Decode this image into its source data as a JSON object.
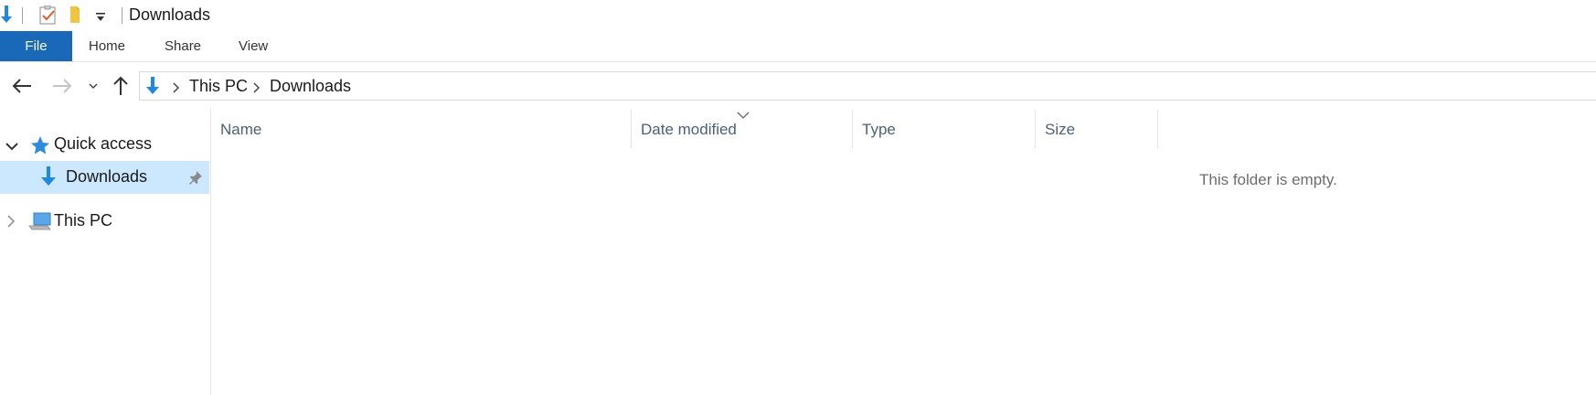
{
  "window": {
    "title": "Downloads"
  },
  "quick_access_toolbar": {
    "icons": [
      "downloads-arrow-icon",
      "properties-icon",
      "new-folder-icon",
      "customize-dropdown-icon"
    ]
  },
  "ribbon": {
    "tabs": [
      {
        "label": "File",
        "active": true
      },
      {
        "label": "Home"
      },
      {
        "label": "Share"
      },
      {
        "label": "View"
      }
    ]
  },
  "navigation": {
    "breadcrumb": [
      "This PC",
      "Downloads"
    ]
  },
  "nav_pane": {
    "quick_access": {
      "label": "Quick access",
      "expanded": true
    },
    "downloads": {
      "label": "Downloads",
      "selected": true,
      "pinned": true
    },
    "this_pc": {
      "label": "This PC",
      "expanded": false
    }
  },
  "file_list": {
    "columns": [
      {
        "label": "Name"
      },
      {
        "label": "Date modified",
        "sorted": "descending"
      },
      {
        "label": "Type"
      },
      {
        "label": "Size"
      }
    ],
    "empty_message": "This folder is empty."
  },
  "colors": {
    "file_tab": "#1a69b8",
    "selection": "#cce8ff",
    "header_text": "#4c607a",
    "arrow_blue": "#1e88e5"
  }
}
